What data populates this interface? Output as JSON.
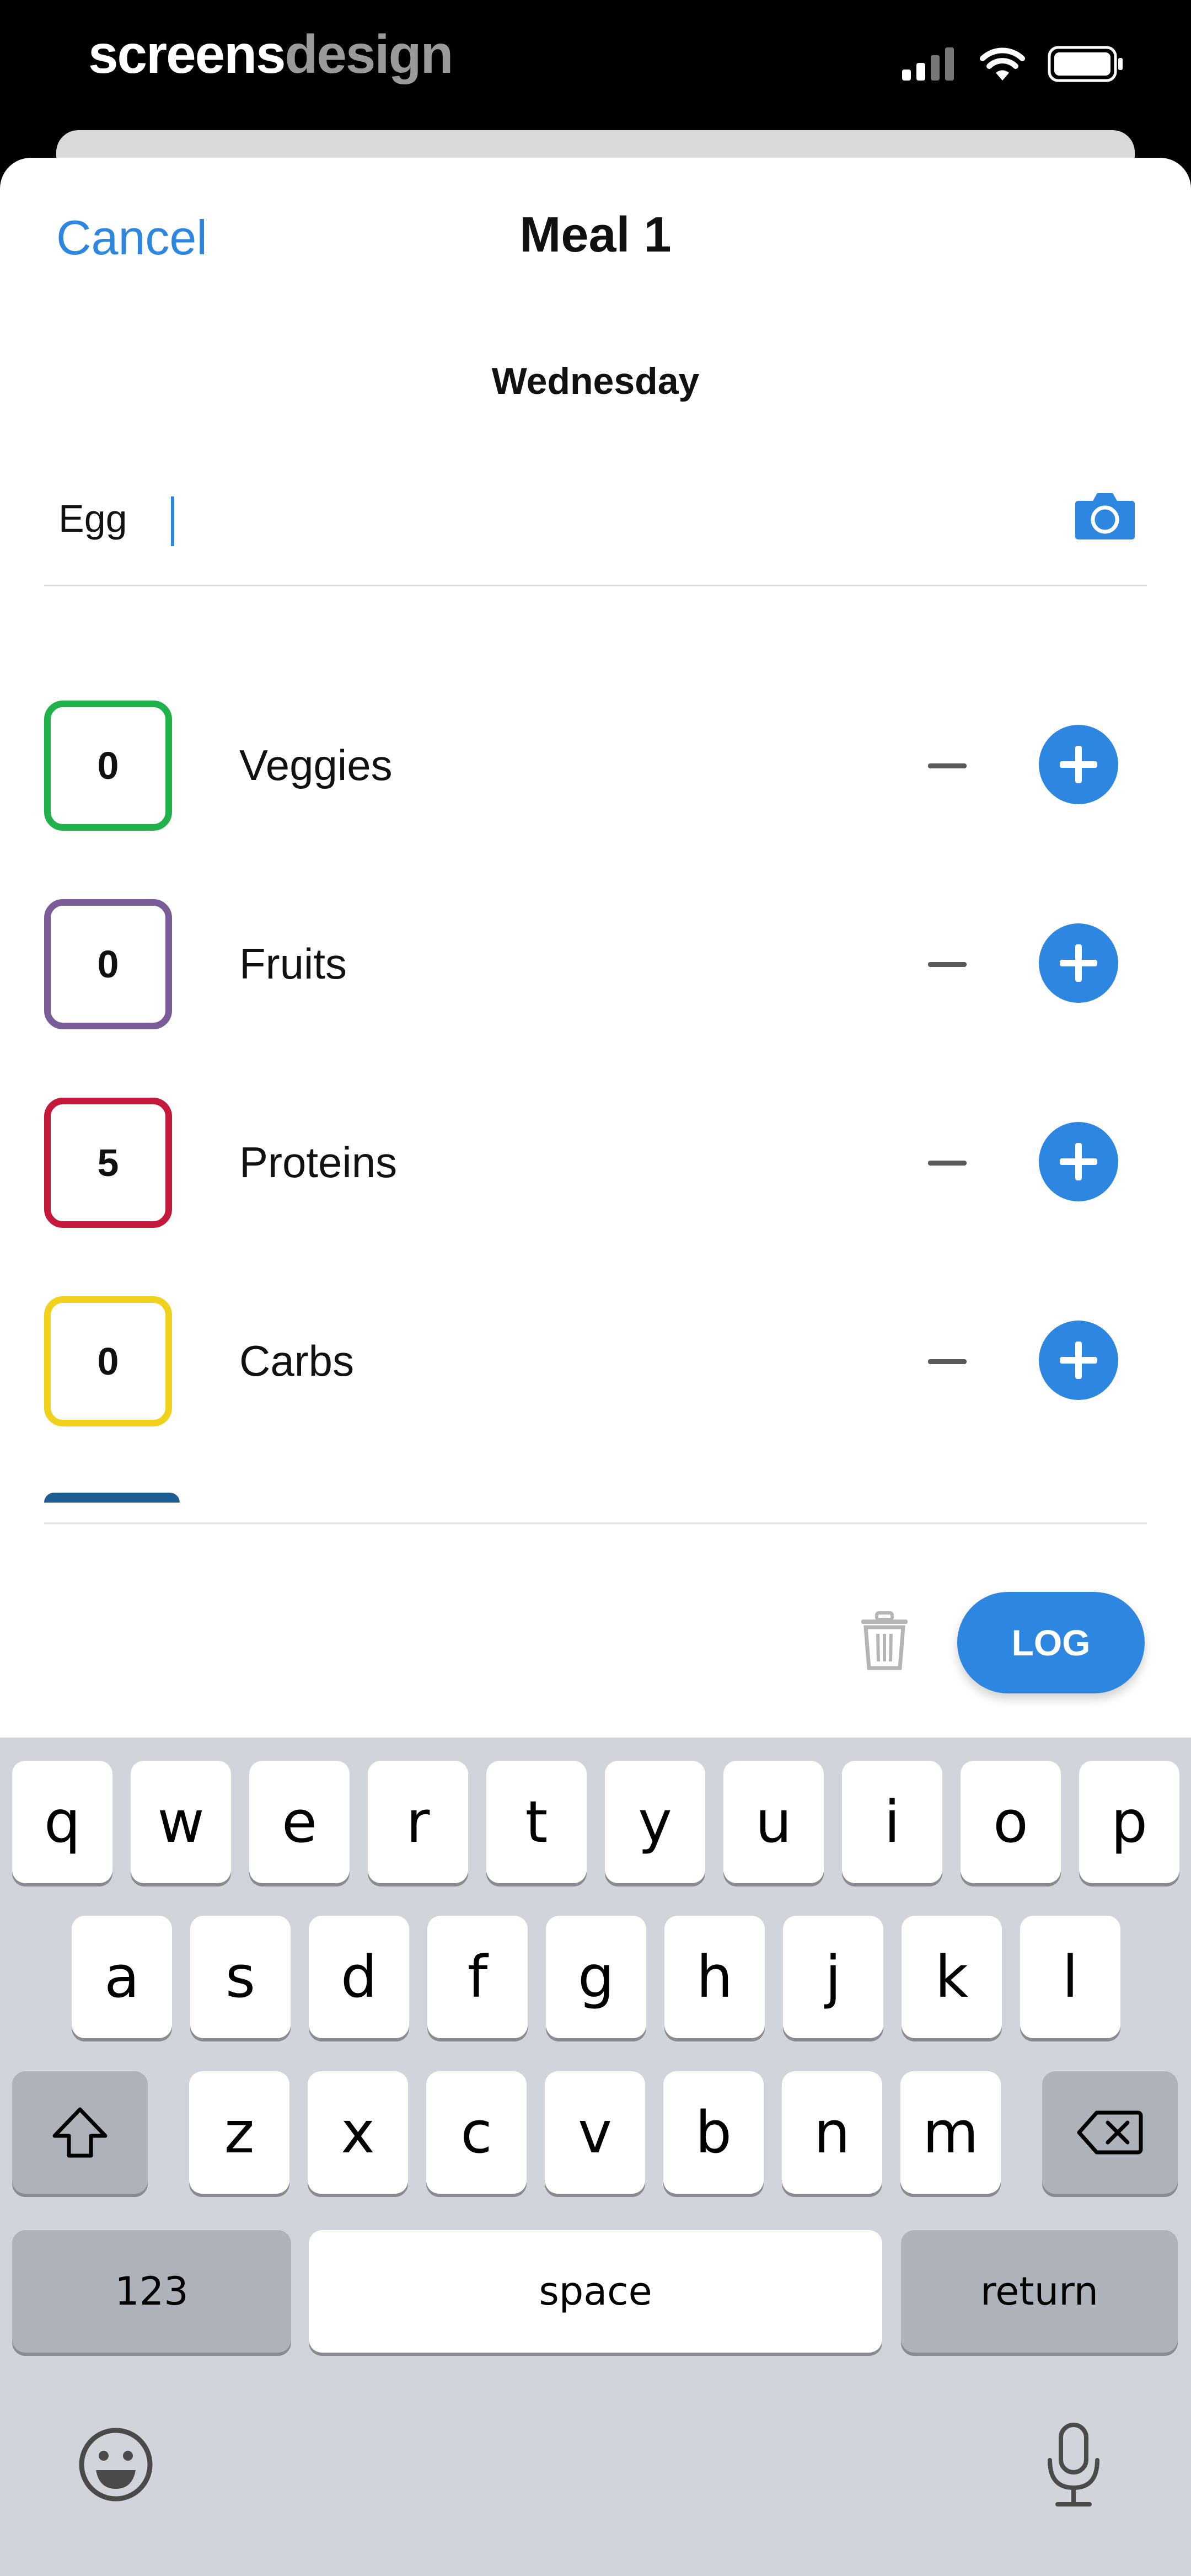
{
  "status_bar": {
    "brand_part1": "screens",
    "brand_part2": "design"
  },
  "header": {
    "cancel_label": "Cancel",
    "title": "Meal 1"
  },
  "day_label": "Wednesday",
  "food_input": {
    "value": "Egg"
  },
  "groups": [
    {
      "count": "0",
      "label": "Veggies",
      "color": "#22b24c"
    },
    {
      "count": "0",
      "label": "Fruits",
      "color": "#7a5c99"
    },
    {
      "count": "5",
      "label": "Proteins",
      "color": "#c4193a"
    },
    {
      "count": "0",
      "label": "Carbs",
      "color": "#f0d21c"
    }
  ],
  "actions": {
    "log_label": "LOG"
  },
  "keyboard": {
    "row1": [
      "q",
      "w",
      "e",
      "r",
      "t",
      "y",
      "u",
      "i",
      "o",
      "p"
    ],
    "row2": [
      "a",
      "s",
      "d",
      "f",
      "g",
      "h",
      "j",
      "k",
      "l"
    ],
    "row3": [
      "z",
      "x",
      "c",
      "v",
      "b",
      "n",
      "m"
    ],
    "numbers_label": "123",
    "space_label": "space",
    "return_label": "return"
  },
  "colors": {
    "accent": "#2d86e0",
    "keyboard_bg": "#d1d4da"
  }
}
